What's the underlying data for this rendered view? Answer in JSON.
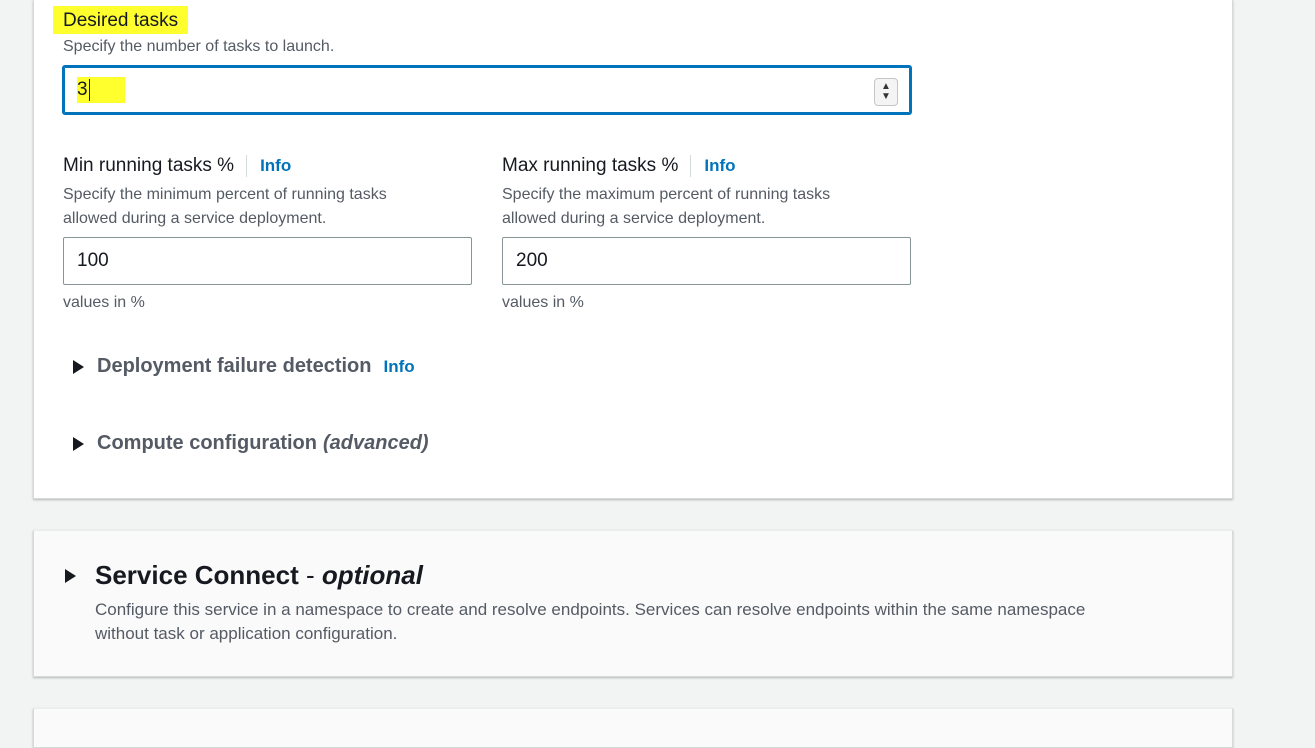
{
  "desired_tasks": {
    "label": "Desired tasks",
    "description": "Specify the number of tasks to launch.",
    "value": "3"
  },
  "min_running": {
    "label": "Min running tasks %",
    "info": "Info",
    "description_line1": "Specify the minimum percent of running tasks",
    "description_line2": "allowed during a service deployment.",
    "value": "100",
    "hint": "values in %"
  },
  "max_running": {
    "label": "Max running tasks %",
    "info": "Info",
    "description_line1": "Specify the maximum percent of running tasks",
    "description_line2": "allowed during a service deployment.",
    "value": "200",
    "hint": "values in %"
  },
  "deployment_failure": {
    "label": "Deployment failure detection",
    "info": "Info"
  },
  "compute_config": {
    "label": "Compute configuration",
    "label_suffix": "(advanced)"
  },
  "service_connect": {
    "title": "Service Connect",
    "separator": " - ",
    "title_suffix": "optional",
    "description_line1": "Configure this service in a namespace to create and resolve endpoints. Services can resolve endpoints within the same namespace",
    "description_line2": "without task or application configuration."
  },
  "colors": {
    "highlight": "#ffff2e",
    "focus_border": "#0073bb",
    "info_link": "#0073bb"
  }
}
